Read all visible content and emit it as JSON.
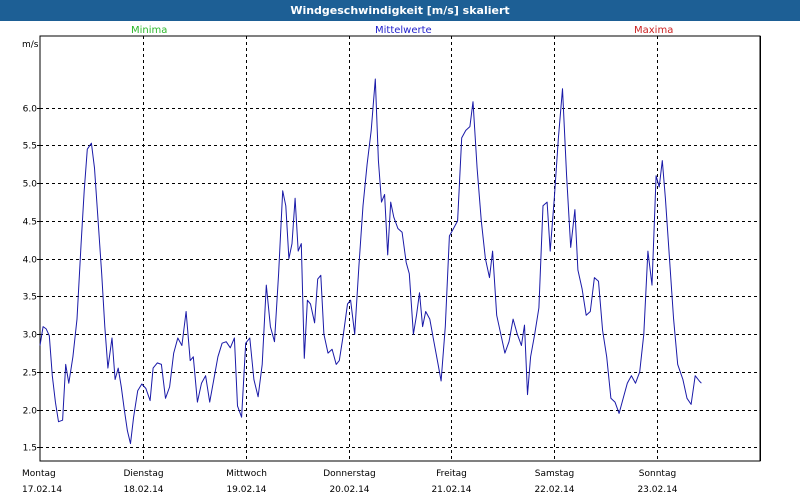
{
  "window": {
    "title": "Windgeschwindigkeit [m/s] skaliert"
  },
  "legend": {
    "items": [
      {
        "label": "Minima",
        "color": "#2db82d"
      },
      {
        "label": "Mittelwerte",
        "color": "#2222cc"
      },
      {
        "label": "Maxima",
        "color": "#cc2222"
      }
    ]
  },
  "chart_data": {
    "type": "line",
    "title": "Windgeschwindigkeit [m/s] skaliert",
    "ylabel": "m/s",
    "xlabel": "",
    "ylim": [
      1.32,
      6.95
    ],
    "yticks": [
      1.5,
      2.0,
      2.5,
      3.0,
      3.5,
      4.0,
      4.5,
      5.0,
      5.5,
      6.0
    ],
    "ytick_labels": [
      "1.5",
      "2.0",
      "2.5",
      "3.0",
      "3.5",
      "4.0",
      "4.5",
      "5.0",
      "5.5",
      "6.0"
    ],
    "grid": true,
    "x_unit": "days since start of 17.02.14",
    "xlim": [
      0,
      7.0
    ],
    "days": [
      {
        "name": "Montag",
        "date": "17.02.14"
      },
      {
        "name": "Dienstag",
        "date": "18.02.14"
      },
      {
        "name": "Mittwoch",
        "date": "19.02.14"
      },
      {
        "name": "Donnerstag",
        "date": "20.02.14"
      },
      {
        "name": "Freitag",
        "date": "21.02.14"
      },
      {
        "name": "Samstag",
        "date": "22.02.14"
      },
      {
        "name": "Sonntag",
        "date": "23.02.14"
      }
    ],
    "series": [
      {
        "name": "Mittelwerte",
        "color": "#1a1aa8",
        "points": [
          [
            0.0,
            2.85
          ],
          [
            0.03,
            3.1
          ],
          [
            0.06,
            3.07
          ],
          [
            0.09,
            2.98
          ],
          [
            0.12,
            2.45
          ],
          [
            0.15,
            2.1
          ],
          [
            0.18,
            1.84
          ],
          [
            0.22,
            1.86
          ],
          [
            0.25,
            2.6
          ],
          [
            0.28,
            2.35
          ],
          [
            0.32,
            2.7
          ],
          [
            0.36,
            3.2
          ],
          [
            0.4,
            4.2
          ],
          [
            0.43,
            4.9
          ],
          [
            0.46,
            5.45
          ],
          [
            0.5,
            5.53
          ],
          [
            0.53,
            5.2
          ],
          [
            0.56,
            4.6
          ],
          [
            0.6,
            3.8
          ],
          [
            0.63,
            3.1
          ],
          [
            0.66,
            2.55
          ],
          [
            0.7,
            2.95
          ],
          [
            0.73,
            2.4
          ],
          [
            0.76,
            2.55
          ],
          [
            0.79,
            2.3
          ],
          [
            0.82,
            2.0
          ],
          [
            0.85,
            1.72
          ],
          [
            0.88,
            1.55
          ],
          [
            0.91,
            1.9
          ],
          [
            0.95,
            2.25
          ],
          [
            0.99,
            2.34
          ],
          [
            1.03,
            2.28
          ],
          [
            1.07,
            2.12
          ],
          [
            1.1,
            2.55
          ],
          [
            1.14,
            2.62
          ],
          [
            1.18,
            2.6
          ],
          [
            1.22,
            2.15
          ],
          [
            1.26,
            2.3
          ],
          [
            1.3,
            2.75
          ],
          [
            1.34,
            2.95
          ],
          [
            1.38,
            2.85
          ],
          [
            1.42,
            3.3
          ],
          [
            1.46,
            2.65
          ],
          [
            1.49,
            2.7
          ],
          [
            1.53,
            2.1
          ],
          [
            1.57,
            2.35
          ],
          [
            1.61,
            2.45
          ],
          [
            1.65,
            2.1
          ],
          [
            1.69,
            2.4
          ],
          [
            1.73,
            2.7
          ],
          [
            1.77,
            2.88
          ],
          [
            1.81,
            2.9
          ],
          [
            1.85,
            2.82
          ],
          [
            1.89,
            2.95
          ],
          [
            1.92,
            2.05
          ],
          [
            1.96,
            1.9
          ],
          [
            2.0,
            2.88
          ],
          [
            2.04,
            2.95
          ],
          [
            2.08,
            2.4
          ],
          [
            2.12,
            2.17
          ],
          [
            2.16,
            2.6
          ],
          [
            2.2,
            3.65
          ],
          [
            2.24,
            3.1
          ],
          [
            2.28,
            2.9
          ],
          [
            2.32,
            3.8
          ],
          [
            2.36,
            4.9
          ],
          [
            2.39,
            4.7
          ],
          [
            2.42,
            4.0
          ],
          [
            2.45,
            4.2
          ],
          [
            2.48,
            4.8
          ],
          [
            2.51,
            4.1
          ],
          [
            2.54,
            4.2
          ],
          [
            2.57,
            2.68
          ],
          [
            2.6,
            3.45
          ],
          [
            2.63,
            3.4
          ],
          [
            2.67,
            3.15
          ],
          [
            2.7,
            3.73
          ],
          [
            2.73,
            3.78
          ],
          [
            2.76,
            3.0
          ],
          [
            2.8,
            2.75
          ],
          [
            2.84,
            2.8
          ],
          [
            2.88,
            2.6
          ],
          [
            2.91,
            2.65
          ],
          [
            2.95,
            3.0
          ],
          [
            2.99,
            3.4
          ],
          [
            3.02,
            3.45
          ],
          [
            3.06,
            3.0
          ],
          [
            3.1,
            3.9
          ],
          [
            3.14,
            4.7
          ],
          [
            3.18,
            5.25
          ],
          [
            3.22,
            5.7
          ],
          [
            3.26,
            6.38
          ],
          [
            3.29,
            5.3
          ],
          [
            3.32,
            4.75
          ],
          [
            3.35,
            4.85
          ],
          [
            3.38,
            4.05
          ],
          [
            3.41,
            4.75
          ],
          [
            3.44,
            4.55
          ],
          [
            3.48,
            4.4
          ],
          [
            3.52,
            4.35
          ],
          [
            3.56,
            3.95
          ],
          [
            3.59,
            3.8
          ],
          [
            3.63,
            3.0
          ],
          [
            3.66,
            3.25
          ],
          [
            3.69,
            3.55
          ],
          [
            3.72,
            3.1
          ],
          [
            3.75,
            3.3
          ],
          [
            3.79,
            3.2
          ],
          [
            3.83,
            2.9
          ],
          [
            3.87,
            2.6
          ],
          [
            3.9,
            2.38
          ],
          [
            3.94,
            3.1
          ],
          [
            3.98,
            4.3
          ],
          [
            4.02,
            4.4
          ],
          [
            4.06,
            4.5
          ],
          [
            4.1,
            5.6
          ],
          [
            4.14,
            5.7
          ],
          [
            4.18,
            5.75
          ],
          [
            4.21,
            6.08
          ],
          [
            4.25,
            5.2
          ],
          [
            4.29,
            4.5
          ],
          [
            4.33,
            4.0
          ],
          [
            4.37,
            3.75
          ],
          [
            4.4,
            4.1
          ],
          [
            4.44,
            3.25
          ],
          [
            4.48,
            3.0
          ],
          [
            4.52,
            2.75
          ],
          [
            4.56,
            2.9
          ],
          [
            4.6,
            3.2
          ],
          [
            4.64,
            3.0
          ],
          [
            4.68,
            2.85
          ],
          [
            4.71,
            3.12
          ],
          [
            4.74,
            2.2
          ],
          [
            4.77,
            2.7
          ],
          [
            4.81,
            3.0
          ],
          [
            4.85,
            3.35
          ],
          [
            4.89,
            4.7
          ],
          [
            4.93,
            4.75
          ],
          [
            4.96,
            4.1
          ],
          [
            5.0,
            4.8
          ],
          [
            5.04,
            5.6
          ],
          [
            5.08,
            6.25
          ],
          [
            5.12,
            5.1
          ],
          [
            5.16,
            4.15
          ],
          [
            5.2,
            4.65
          ],
          [
            5.23,
            3.85
          ],
          [
            5.27,
            3.6
          ],
          [
            5.31,
            3.25
          ],
          [
            5.35,
            3.3
          ],
          [
            5.39,
            3.75
          ],
          [
            5.43,
            3.7
          ],
          [
            5.47,
            3.05
          ],
          [
            5.51,
            2.7
          ],
          [
            5.55,
            2.15
          ],
          [
            5.59,
            2.1
          ],
          [
            5.63,
            1.95
          ],
          [
            5.67,
            2.15
          ],
          [
            5.71,
            2.35
          ],
          [
            5.75,
            2.45
          ],
          [
            5.79,
            2.35
          ],
          [
            5.83,
            2.5
          ],
          [
            5.87,
            3.0
          ],
          [
            5.91,
            4.1
          ],
          [
            5.95,
            3.65
          ],
          [
            5.99,
            5.1
          ],
          [
            6.02,
            4.95
          ],
          [
            6.05,
            5.3
          ],
          [
            6.08,
            4.8
          ],
          [
            6.12,
            4.0
          ],
          [
            6.16,
            3.2
          ],
          [
            6.2,
            2.6
          ],
          [
            6.25,
            2.4
          ],
          [
            6.29,
            2.15
          ],
          [
            6.33,
            2.07
          ],
          [
            6.37,
            2.45
          ],
          [
            6.41,
            2.38
          ],
          [
            6.43,
            2.35
          ]
        ]
      }
    ]
  }
}
